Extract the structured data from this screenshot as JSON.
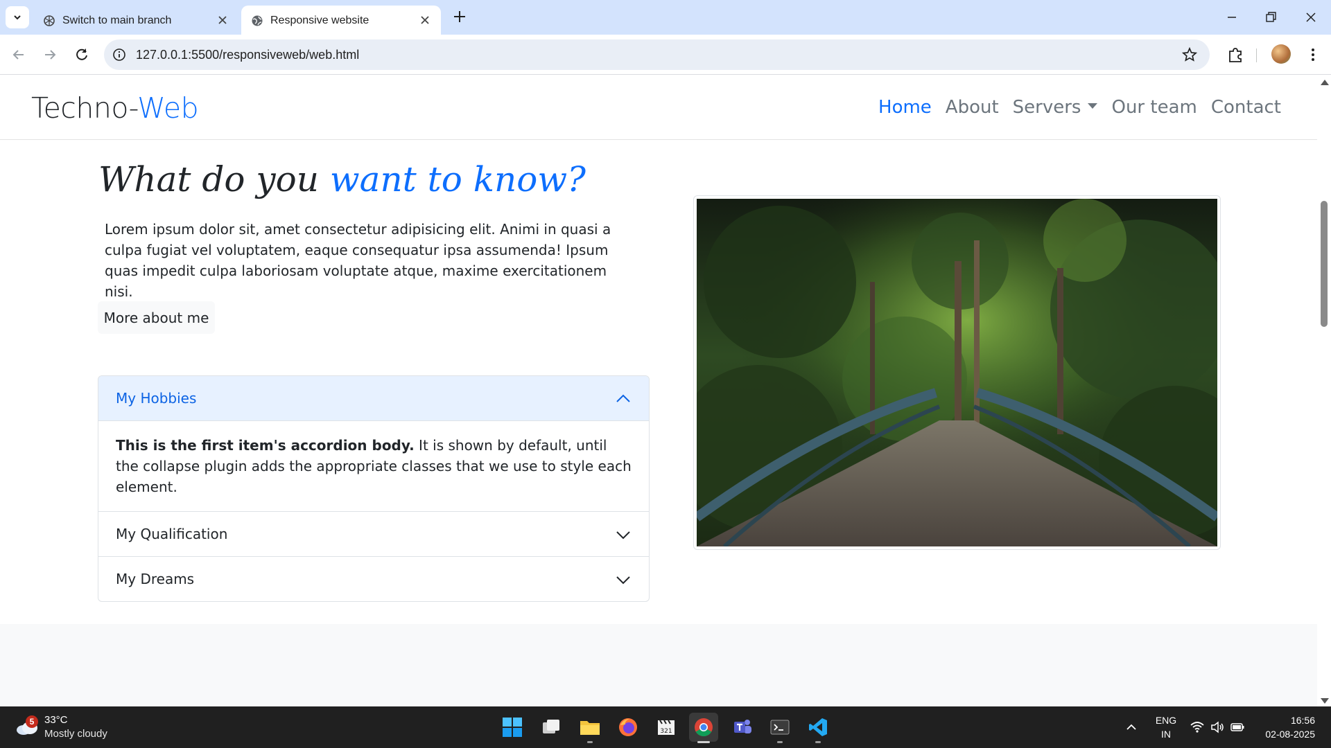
{
  "browser": {
    "tabs": [
      {
        "title": "Switch to main branch",
        "favicon": "openai-icon",
        "active": false
      },
      {
        "title": "Responsive website",
        "favicon": "globe-icon",
        "active": true
      }
    ],
    "url": "127.0.0.1:5500/responsiveweb/web.html"
  },
  "site": {
    "brand_main": "Techno-",
    "brand_accent": "Web",
    "nav": {
      "home": "Home",
      "about": "About",
      "servers": "Servers",
      "team": "Our team",
      "contact": "Contact"
    },
    "headline_main": "What do you ",
    "headline_accent": "want to know?",
    "lead": "Lorem ipsum dolor sit, amet consectetur adipisicing elit. Animi in quasi a culpa fugiat vel voluptatem, eaque consequatur ipsa assumenda! Ipsum quas impedit culpa laboriosam voluptate atque, maxime exercitationem nisi.",
    "more_button": "More about me",
    "accordion": {
      "item1_title": "My Hobbies",
      "item1_body_bold": "This is the first item's accordion body.",
      "item1_body_rest": " It is shown by default, until the collapse plugin adds the appropriate classes that we use to style each element.",
      "item2_title": "My Qualification",
      "item3_title": "My Dreams"
    },
    "colors": {
      "accent": "#0d6efd",
      "text": "#212529",
      "muted": "#6c757d"
    }
  },
  "taskbar": {
    "weather_badge": "5",
    "temperature": "33°C",
    "condition": "Mostly cloudy",
    "lang_line1": "ENG",
    "lang_line2": "IN",
    "time": "16:56",
    "date": "02-08-2025"
  }
}
